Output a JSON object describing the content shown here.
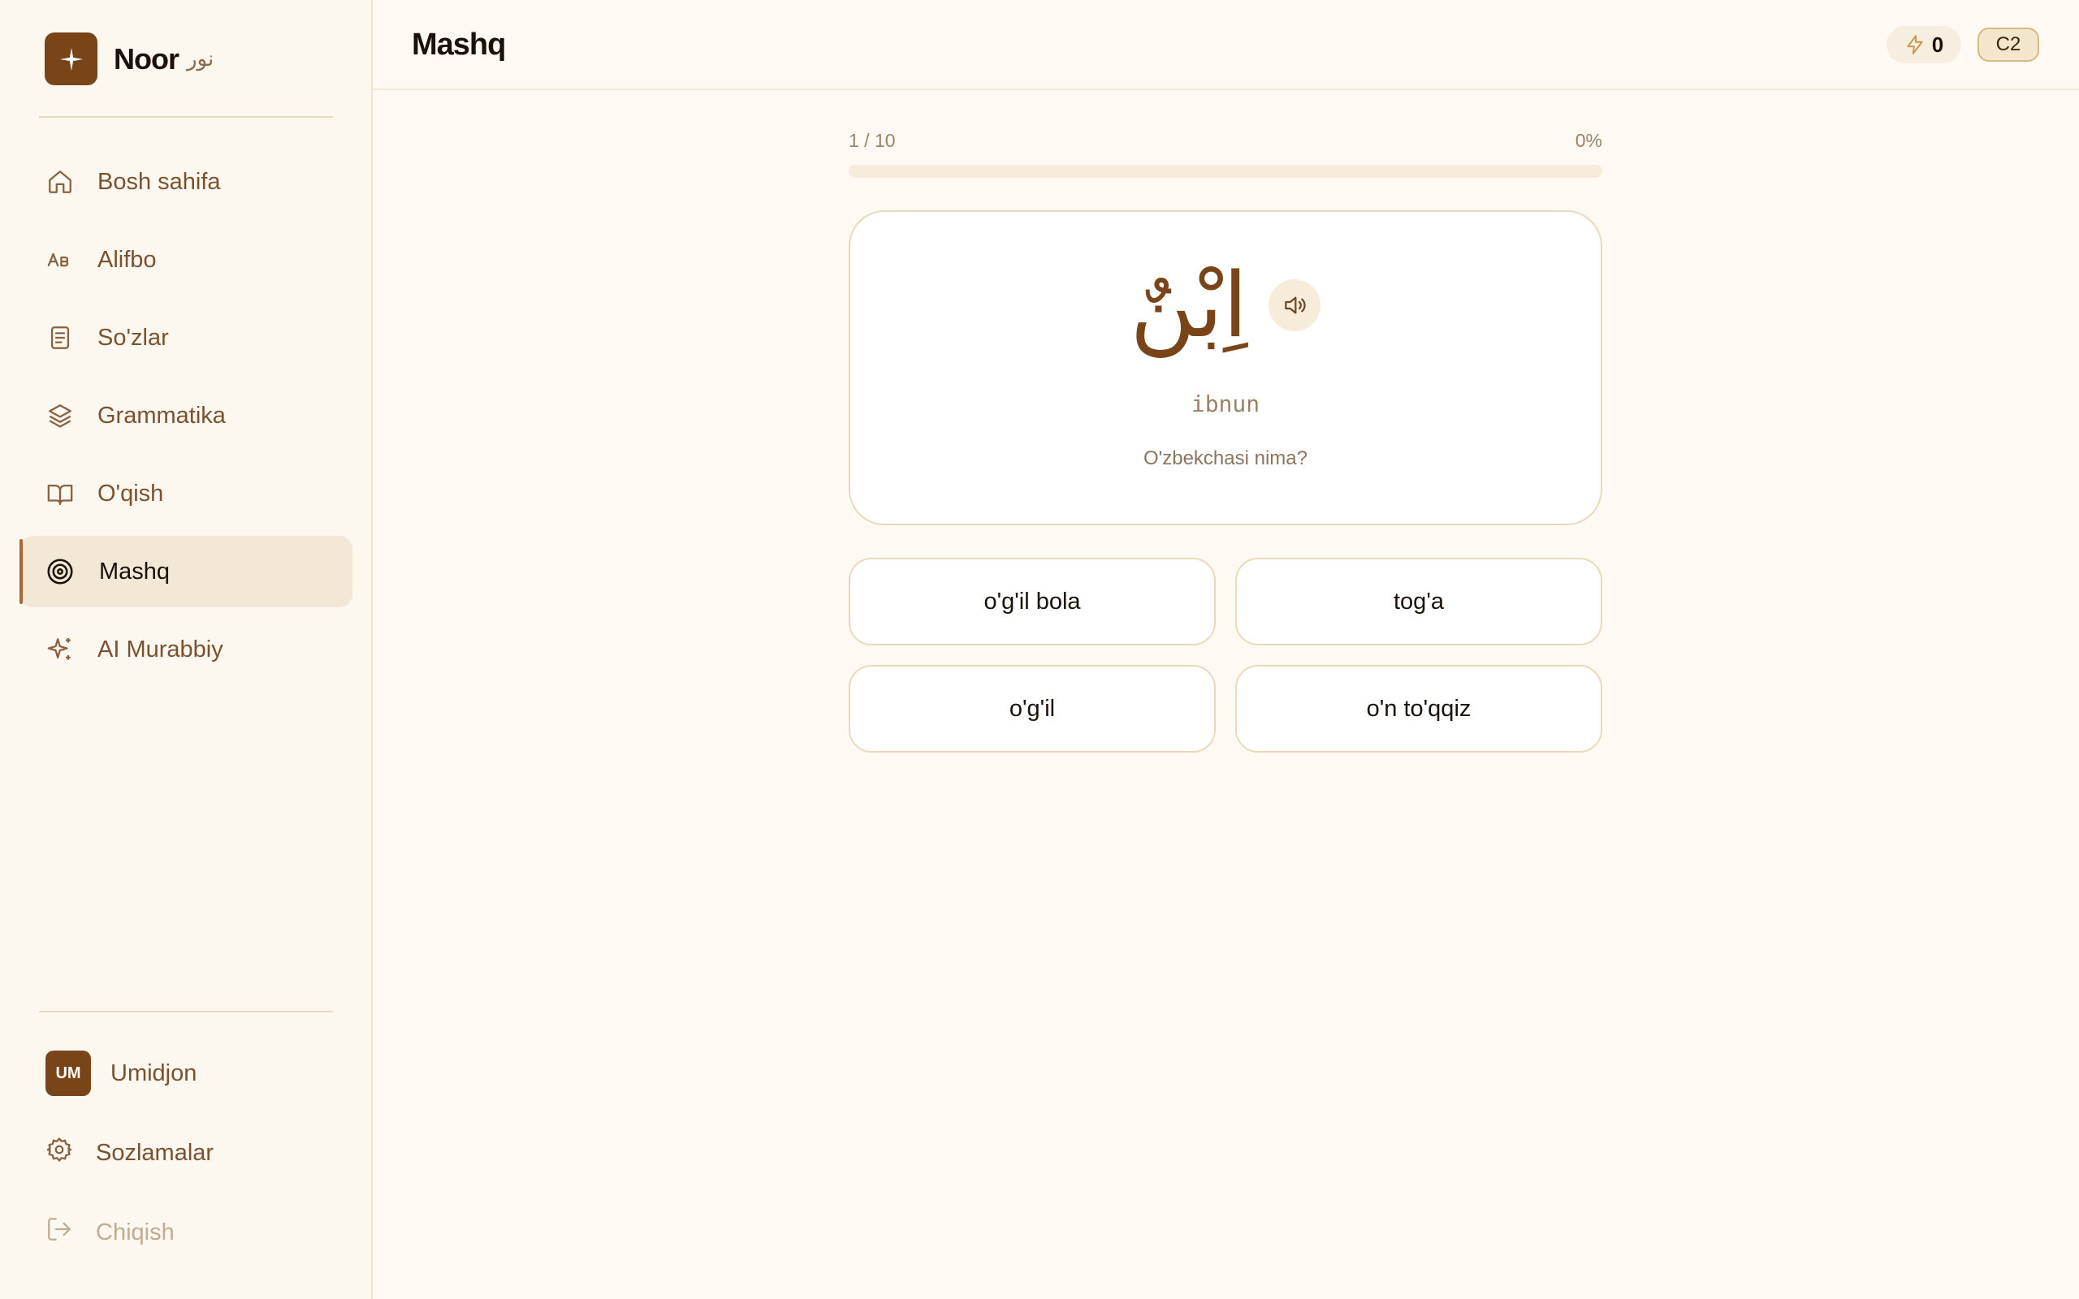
{
  "brand": {
    "name": "Noor",
    "arabic": "نور"
  },
  "sidebar": {
    "items": [
      {
        "label": "Bosh sahifa",
        "icon": "home-icon"
      },
      {
        "label": "Alifbo",
        "icon": "alphabet-icon"
      },
      {
        "label": "So'zlar",
        "icon": "document-icon"
      },
      {
        "label": "Grammatika",
        "icon": "layers-icon"
      },
      {
        "label": "O'qish",
        "icon": "book-icon"
      },
      {
        "label": "Mashq",
        "icon": "target-icon",
        "active": true
      },
      {
        "label": "AI Murabbiy",
        "icon": "sparkles-icon"
      }
    ],
    "user": {
      "initials": "UM",
      "name": "Umidjon"
    },
    "settings_label": "Sozlamalar",
    "logout_label": "Chiqish"
  },
  "header": {
    "title": "Mashq",
    "xp": "0",
    "level": "C2"
  },
  "quiz": {
    "counter": "1 / 10",
    "percent": "0%",
    "progress": 0,
    "word": "اِبْنٌ",
    "transliteration": "ibnun",
    "question": "O'zbekchasi nima?",
    "options": [
      "o'g'il bola",
      "tog'a",
      "o'g'il",
      "o'n to'qqiz"
    ]
  },
  "colors": {
    "accent": "#7a4419",
    "accent_light": "#a76a34",
    "background": "#fefaf3"
  }
}
